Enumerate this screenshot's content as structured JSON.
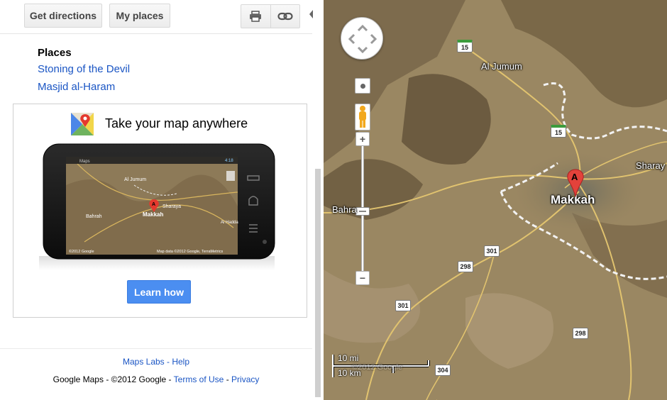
{
  "toolbar": {
    "get_directions": "Get directions",
    "my_places": "My places",
    "print_icon": "print-icon",
    "link_icon": "link-icon"
  },
  "places": {
    "title": "Places",
    "items": [
      "Stoning of the Devil",
      "Masjid al-Haram"
    ]
  },
  "promo": {
    "title": "Take your map anywhere",
    "cta": "Learn how",
    "phone_screen": {
      "app_title": "Maps",
      "time": "4:18",
      "labels": {
        "al_jumum": "Al Jumum",
        "sharaya": "Sharaya",
        "bahrah": "Bahrah",
        "makkah": "Makkah",
        "al_hadda": "Al Hadda",
        "copyright": "©2012 Google",
        "map_data": "Map data ©2012 Google, TerraMetrics"
      }
    }
  },
  "footer": {
    "maps_labs": "Maps Labs",
    "dash": " - ",
    "help": "Help",
    "legal_prefix": "Google Maps - ©2012 Google - ",
    "terms": "Terms of Use",
    "privacy": "Privacy"
  },
  "map": {
    "labels": {
      "al_jumum": "Al Jumum",
      "makkah": "Makkah",
      "sharaya": "Sharay",
      "bahrah": "Bahra"
    },
    "marker": "A",
    "shields": {
      "r15_top": "15",
      "r15_mid": "15",
      "r301_a": "301",
      "r298_a": "298",
      "r301_b": "301",
      "r298_b": "298",
      "r304": "304"
    },
    "scale": {
      "miles": "10 mi",
      "km": "10 km"
    },
    "watermark": "©2012 Google"
  },
  "colors": {
    "link": "#1a55c4",
    "button_blue": "#4b8ef1",
    "map_base": "#8f7d5b"
  }
}
